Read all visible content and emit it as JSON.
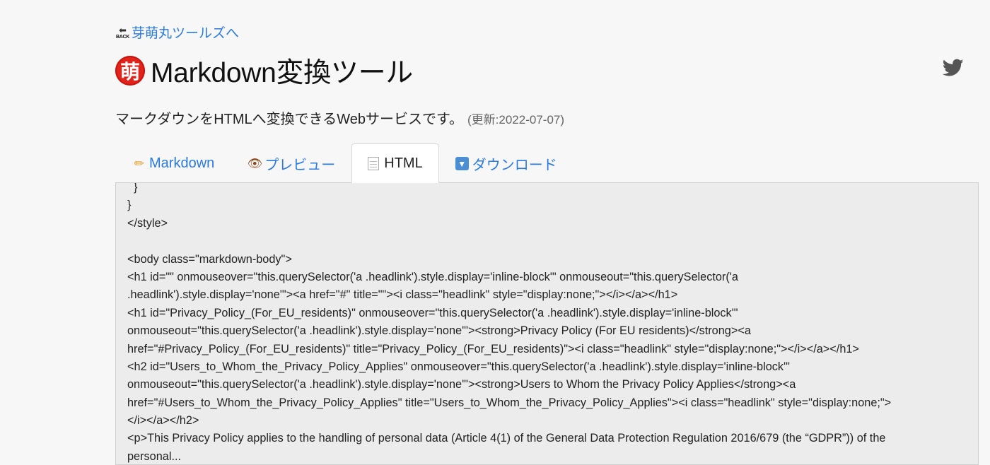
{
  "nav": {
    "back_label": "芽萌丸ツールズへ",
    "back_icon_text": "BACK",
    "back_icon": "back-arrow-icon"
  },
  "header": {
    "logo_char": "萌",
    "title": "Markdown変換ツール",
    "twitter_icon": "twitter-icon",
    "twitter_color": "#555555"
  },
  "description": {
    "text": "マークダウンをHTMLへ変換できるWebサービスです。",
    "updated": "(更新:2022-07-07)"
  },
  "tabs": [
    {
      "label": "Markdown",
      "icon": "pencil-icon",
      "active": false
    },
    {
      "label": "プレビュー",
      "icon": "eye-icon",
      "active": false
    },
    {
      "label": "HTML",
      "icon": "notepad-icon",
      "active": true
    },
    {
      "label": "ダウンロード",
      "icon": "download-icon",
      "active": false
    }
  ],
  "code": {
    "lines": [
      "  }",
      "}",
      "</style>",
      "",
      "<body class=\"markdown-body\">",
      "<h1 id=\"\" onmouseover=\"this.querySelector('a .headlink').style.display='inline-block'\" onmouseout=\"this.querySelector('a",
      ".headlink').style.display='none'\"><a href=\"#\" title=\"\"><i class=\"headlink\" style=\"display:none;\"></i></a></h1>",
      "<h1 id=\"Privacy_Policy_(For_EU_residents)\" onmouseover=\"this.querySelector('a .headlink').style.display='inline-block'\"",
      "onmouseout=\"this.querySelector('a .headlink').style.display='none'\"><strong>Privacy Policy (For EU residents)</strong><a",
      "href=\"#Privacy_Policy_(For_EU_residents)\" title=\"Privacy_Policy_(For_EU_residents)\"><i class=\"headlink\" style=\"display:none;\"></i></a></h1>",
      "<h2 id=\"Users_to_Whom_the_Privacy_Policy_Applies\" onmouseover=\"this.querySelector('a .headlink').style.display='inline-block'\"",
      "onmouseout=\"this.querySelector('a .headlink').style.display='none'\"><strong>Users to Whom the Privacy Policy Applies</strong><a",
      "href=\"#Users_to_Whom_the_Privacy_Policy_Applies\" title=\"Users_to_Whom_the_Privacy_Policy_Applies\"><i class=\"headlink\" style=\"display:none;\">",
      "</i></a></h2>",
      "<p>This Privacy Policy applies to the handling of personal data (Article 4(1) of the General Data Protection Regulation 2016/679 (the “GDPR”)) of the",
      "personal..."
    ]
  }
}
